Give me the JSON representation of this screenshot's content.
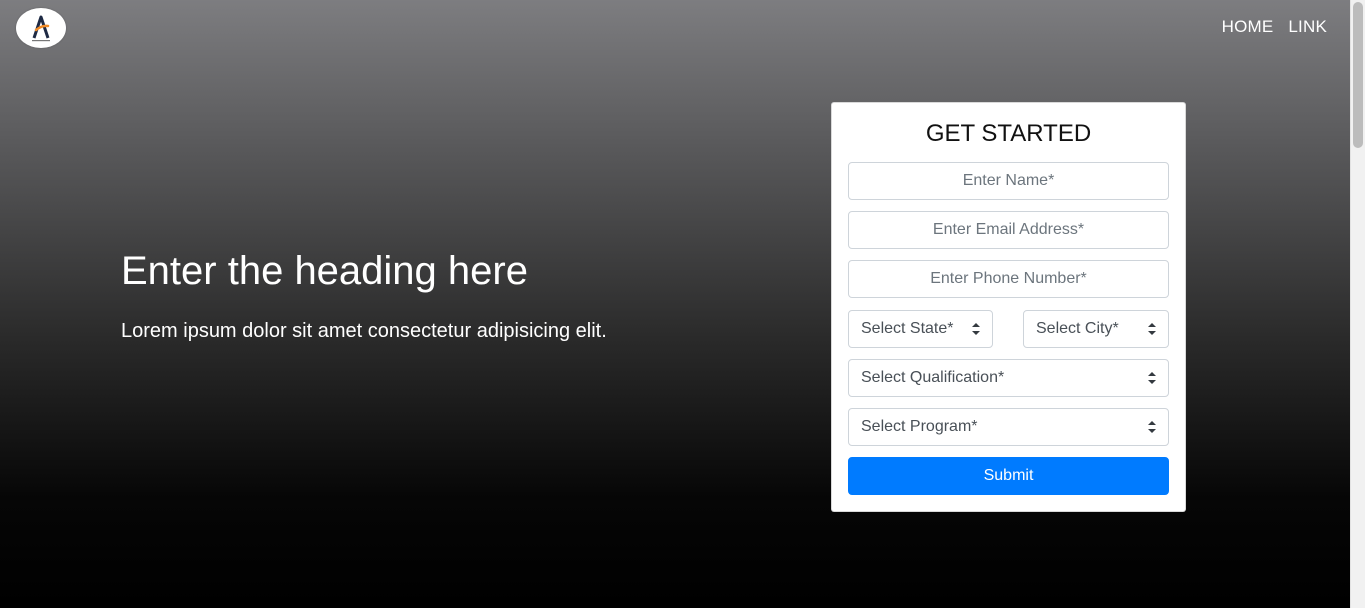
{
  "nav": {
    "home_label": "HOME",
    "link_label": "LINK"
  },
  "hero": {
    "heading": "Enter the heading here",
    "text": "Lorem ipsum dolor sit amet consectetur adipisicing elit."
  },
  "form": {
    "title": "GET STARTED",
    "name_placeholder": "Enter Name*",
    "email_placeholder": "Enter Email Address*",
    "phone_placeholder": "Enter Phone Number*",
    "state_selected": "Select State*",
    "city_selected": "Select City*",
    "qualification_selected": "Select Qualification*",
    "program_selected": "Select Program*",
    "submit_label": "Submit"
  },
  "colors": {
    "accent": "#007bff",
    "logo_orange": "#f28c28"
  },
  "icons": {
    "logo": "brand-logo-icon",
    "select_caret": "chevron-up-down-icon"
  }
}
